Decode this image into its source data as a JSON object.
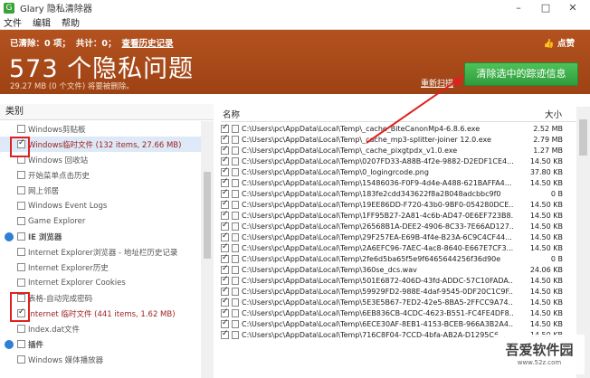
{
  "titlebar": {
    "title": "Glary 隐私清除器",
    "min": "–",
    "max": "□",
    "close": "✕"
  },
  "menu": [
    "文件",
    "编辑",
    "帮助"
  ],
  "banner": {
    "cleared": "已清除：0 项；",
    "total": "共计：0；",
    "history": "查看历史记录",
    "headline": "573 个隐私问题",
    "subtext": "29.27 MB (0 个文件) 将要被删除。",
    "like": "点赞",
    "rescan": "重新扫描",
    "clean_button": "清除选中的踪迹信息"
  },
  "left": {
    "header": "类别",
    "items": [
      {
        "label": "Windows剪贴板",
        "checked": false,
        "type": "child"
      },
      {
        "label": "Windows临时文件 (132 items, 27.66 MB)",
        "checked": true,
        "type": "child",
        "highlight": true,
        "selected": true
      },
      {
        "label": "Windows 回收站",
        "checked": false,
        "type": "child"
      },
      {
        "label": "开始菜单点击历史",
        "checked": false,
        "type": "child"
      },
      {
        "label": "网上邻居",
        "checked": false,
        "type": "child"
      },
      {
        "label": "Windows Event Logs",
        "checked": false,
        "type": "child"
      },
      {
        "label": "Game Explorer",
        "checked": false,
        "type": "child"
      },
      {
        "label": "IE 浏览器",
        "checked": false,
        "type": "group"
      },
      {
        "label": "Internet Explorer浏览器 - 地址栏历史记录",
        "checked": false,
        "type": "child"
      },
      {
        "label": "Internet Explorer历史",
        "checked": false,
        "type": "child"
      },
      {
        "label": "Internet Explorer Cookies",
        "checked": false,
        "type": "child"
      },
      {
        "label": "表格-自动完成密码",
        "checked": false,
        "type": "child"
      },
      {
        "label": "Internet 临时文件 (441 items, 1.62 MB)",
        "checked": true,
        "type": "child",
        "highlight": true
      },
      {
        "label": "Index.dat文件",
        "checked": false,
        "type": "child"
      },
      {
        "label": "插件",
        "checked": false,
        "type": "group"
      },
      {
        "label": "Windows 媒体播放器",
        "checked": false,
        "type": "child"
      }
    ]
  },
  "right": {
    "col_name": "名称",
    "col_size": "大小",
    "files": [
      {
        "path": "C:\\Users\\pc\\AppData\\Local\\Temp\\_cache_BiteCanonMp4-6.8.6.exe",
        "size": "2.52 MB"
      },
      {
        "path": "C:\\Users\\pc\\AppData\\Local\\Temp\\_cache_mp3-splitter-joiner 12.0.exe",
        "size": "2.79 MB"
      },
      {
        "path": "C:\\Users\\pc\\AppData\\Local\\Temp\\_cache_pixgtpdx_v1.0.exe",
        "size": "1.27 MB"
      },
      {
        "path": "C:\\Users\\pc\\AppData\\Local\\Temp\\0207FD33-A88B-4f2e-9882-D2EDF1CE4...",
        "size": "14.50 KB"
      },
      {
        "path": "C:\\Users\\pc\\AppData\\Local\\Temp\\0_logingrcode.png",
        "size": "37.80 KB"
      },
      {
        "path": "C:\\Users\\pc\\AppData\\Local\\Temp\\15486036-F0F9-4d4e-A488-621BAFFA4...",
        "size": "14.50 KB"
      },
      {
        "path": "C:\\Users\\pc\\AppData\\Local\\Temp\\183fe2cdd343622f8a28048adcbbc9f0",
        "size": "0 B"
      },
      {
        "path": "C:\\Users\\pc\\AppData\\Local\\Temp\\19EE86DD-F720-43b0-9BF0-054280DCE...",
        "size": "14.50 KB"
      },
      {
        "path": "C:\\Users\\pc\\AppData\\Local\\Temp\\1FF95B27-2A81-4c6b-AD47-0E6EF723B8...",
        "size": "14.50 KB"
      },
      {
        "path": "C:\\Users\\pc\\AppData\\Local\\Temp\\26568B1A-DEE2-4906-8C33-7E66AD127...",
        "size": "14.50 KB"
      },
      {
        "path": "C:\\Users\\pc\\AppData\\Local\\Temp\\29F257EA-E69B-4f4e-B23A-6C9C4CF44...",
        "size": "14.50 KB"
      },
      {
        "path": "C:\\Users\\pc\\AppData\\Local\\Temp\\2A6EFC96-7AEC-4ac8-8640-E667E7CF3...",
        "size": "14.50 KB"
      },
      {
        "path": "C:\\Users\\pc\\AppData\\Local\\Temp\\2fe6d5ba65f5e9f6465644256f36d90e",
        "size": "0 B"
      },
      {
        "path": "C:\\Users\\pc\\AppData\\Local\\Temp\\360se_dcs.wav",
        "size": "24.06 KB"
      },
      {
        "path": "C:\\Users\\pc\\AppData\\Local\\Temp\\501E6872-406D-43fd-ADDC-57C10FADA...",
        "size": "14.50 KB"
      },
      {
        "path": "C:\\Users\\pc\\AppData\\Local\\Temp\\59929FD2-988E-4daf-9545-0DF20C1C9F...",
        "size": "14.50 KB"
      },
      {
        "path": "C:\\Users\\pc\\AppData\\Local\\Temp\\5E3E5B67-7ED2-42e5-8BA5-2FFCC9A74...",
        "size": "14.50 KB"
      },
      {
        "path": "C:\\Users\\pc\\AppData\\Local\\Temp\\6EB836CB-4CDC-4623-B551-FC4FE4DF8...",
        "size": "14.50 KB"
      },
      {
        "path": "C:\\Users\\pc\\AppData\\Local\\Temp\\6ECE30AF-8EB1-4153-BCEB-966A3B2A4...",
        "size": "14.50 KB"
      },
      {
        "path": "C:\\Users\\pc\\AppData\\Local\\Temp\\716C8F04-7CCD-4bfa-AB2A-D1295C6...",
        "size": "14.50 KB"
      }
    ]
  },
  "watermark": {
    "text": "吾爱软件园",
    "url": "www.52z.com"
  },
  "colors": {
    "banner": "#a54a18",
    "button": "#3caf48",
    "annotation": "#e02020"
  }
}
